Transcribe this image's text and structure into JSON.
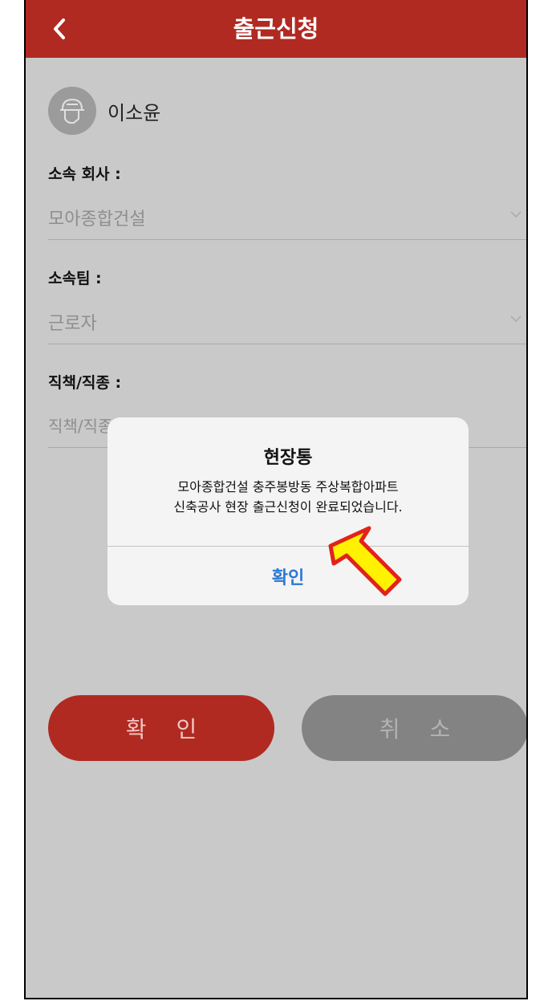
{
  "header": {
    "title": "출근신청",
    "back_icon": "chevron-left-icon"
  },
  "user": {
    "name": "이소윤",
    "avatar_icon": "worker-helmet-icon"
  },
  "form": {
    "company": {
      "label": "소속 회사 :",
      "value": "모아종합건설"
    },
    "team": {
      "label": "소속팀 :",
      "value": "근로자"
    },
    "position": {
      "label": "직책/직종 :",
      "placeholder": "직책/직종을 입력해주세요"
    }
  },
  "buttons": {
    "confirm": "확 인",
    "cancel": "취 소"
  },
  "dialog": {
    "title": "현장통",
    "message_line1": "모아종합건설  충주봉방동 주상복합아파트",
    "message_line2": "신축공사 현장 출근신청이 완료되었습니다.",
    "ok": "확인"
  },
  "colors": {
    "brand_red": "#b02a22",
    "dialog_link_blue": "#2a78d4",
    "highlight_yellow": "#fff200"
  }
}
